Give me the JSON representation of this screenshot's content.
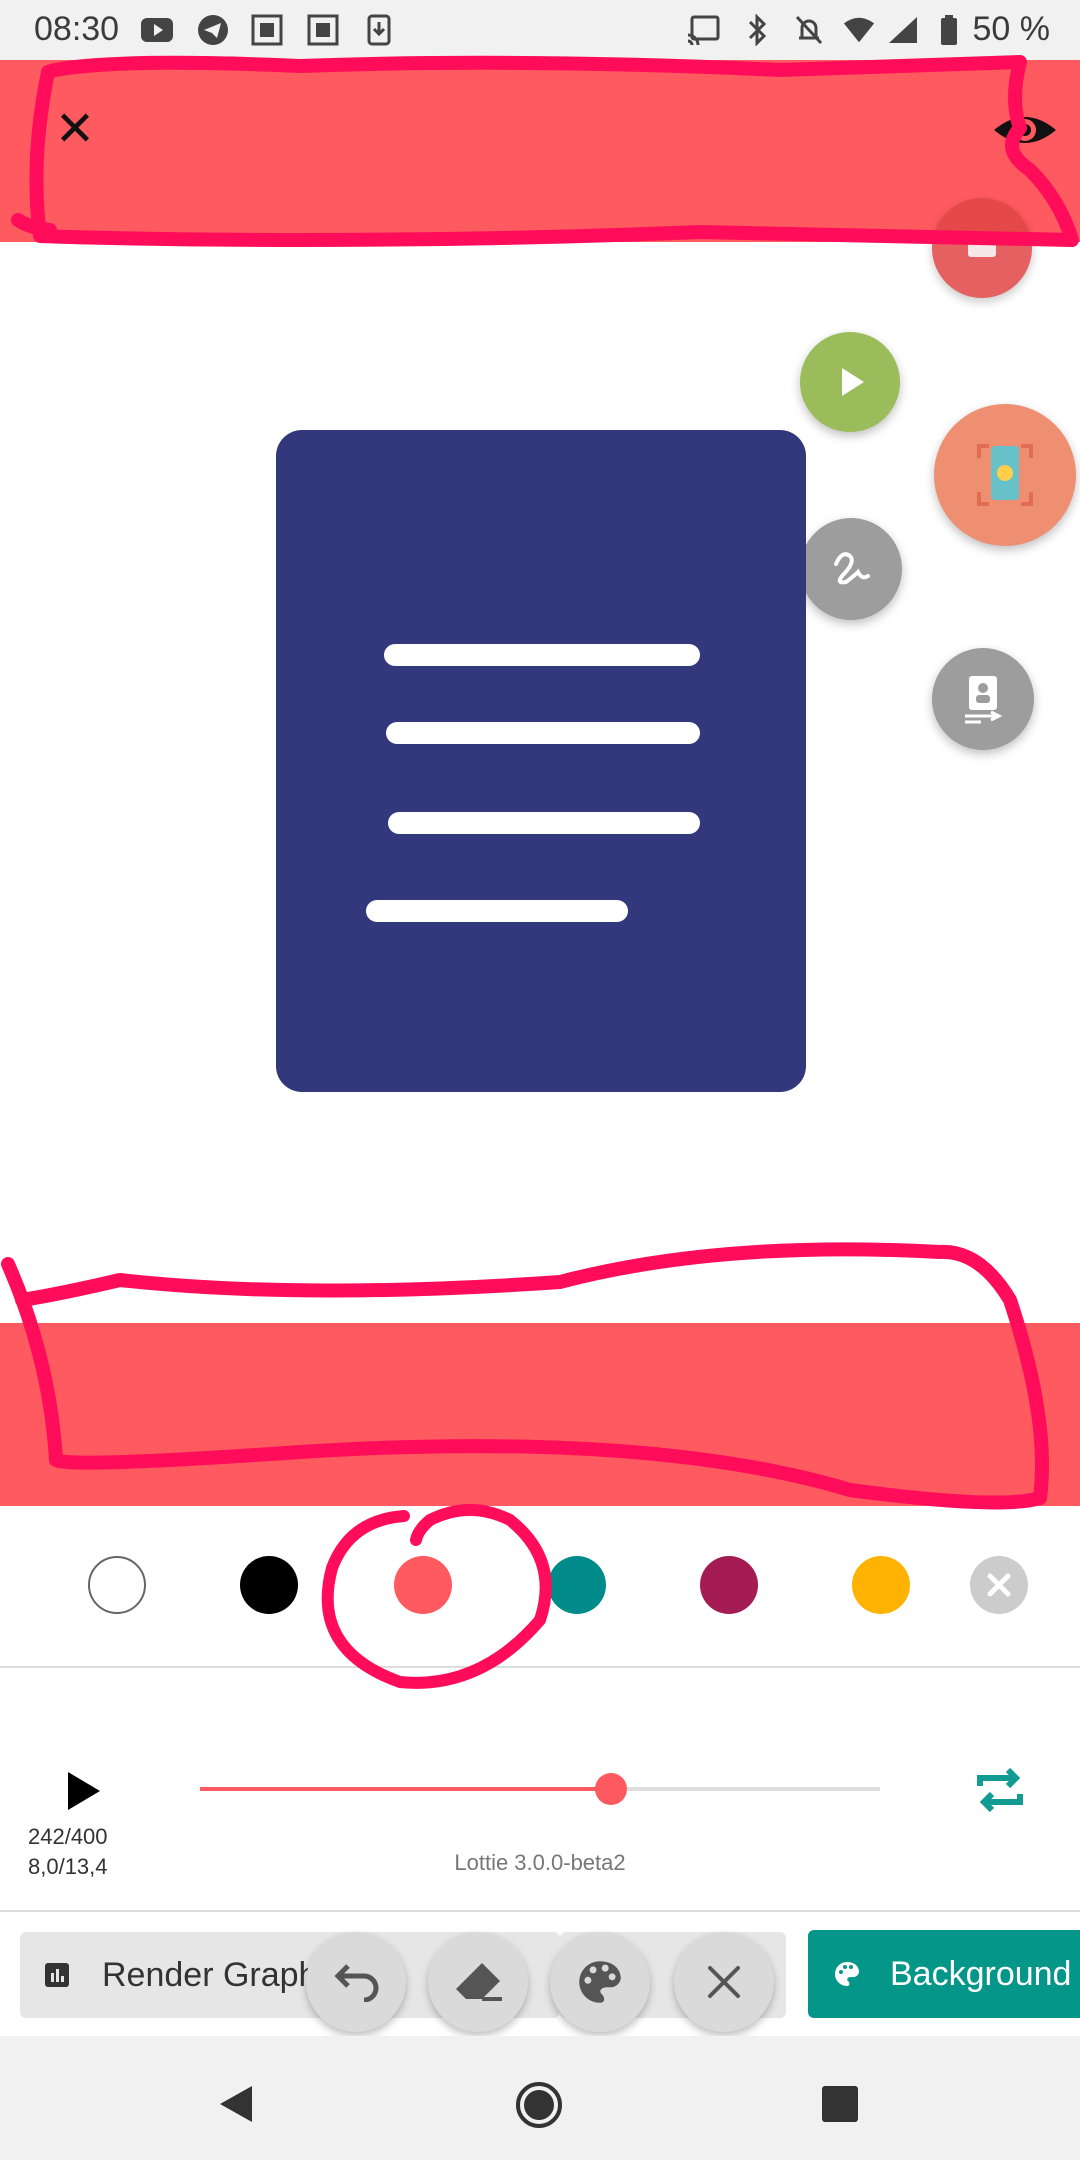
{
  "status_bar": {
    "time": "08:30",
    "battery": "50 %",
    "icons": [
      "youtube-icon",
      "telegram-icon",
      "screenshot-icon",
      "screenshot-icon",
      "download-icon",
      "cast-icon",
      "bluetooth-icon",
      "notifications-off-icon",
      "wifi-icon",
      "signal-icon",
      "battery-icon"
    ]
  },
  "toolbar": {
    "close_icon": "close-icon",
    "preview_icon": "eye-icon",
    "color": "#ff5a5f"
  },
  "fabs": [
    "stop-icon",
    "play-icon",
    "screen-record-icon",
    "draw-icon",
    "export-icon"
  ],
  "palette": {
    "swatches": [
      {
        "color": "#ffffff",
        "name": "white"
      },
      {
        "color": "#000000",
        "name": "black"
      },
      {
        "color": "#ff5a5f",
        "name": "coral",
        "selected": true
      },
      {
        "color": "#008b8b",
        "name": "teal"
      },
      {
        "color": "#a51c55",
        "name": "magenta"
      },
      {
        "color": "#ffb300",
        "name": "amber"
      }
    ],
    "clear_icon": "close-circle-icon"
  },
  "player": {
    "frame": "242/400",
    "time": "8,0/13,4",
    "progress": 0.605,
    "version": "Lottie 3.0.0-beta2"
  },
  "chips": {
    "render_graph": "Render Graph",
    "background": "Background"
  },
  "tools": [
    "undo-icon",
    "eraser-icon",
    "palette-icon",
    "close-icon"
  ],
  "nav": [
    "back-icon",
    "home-icon",
    "recents-icon"
  ]
}
